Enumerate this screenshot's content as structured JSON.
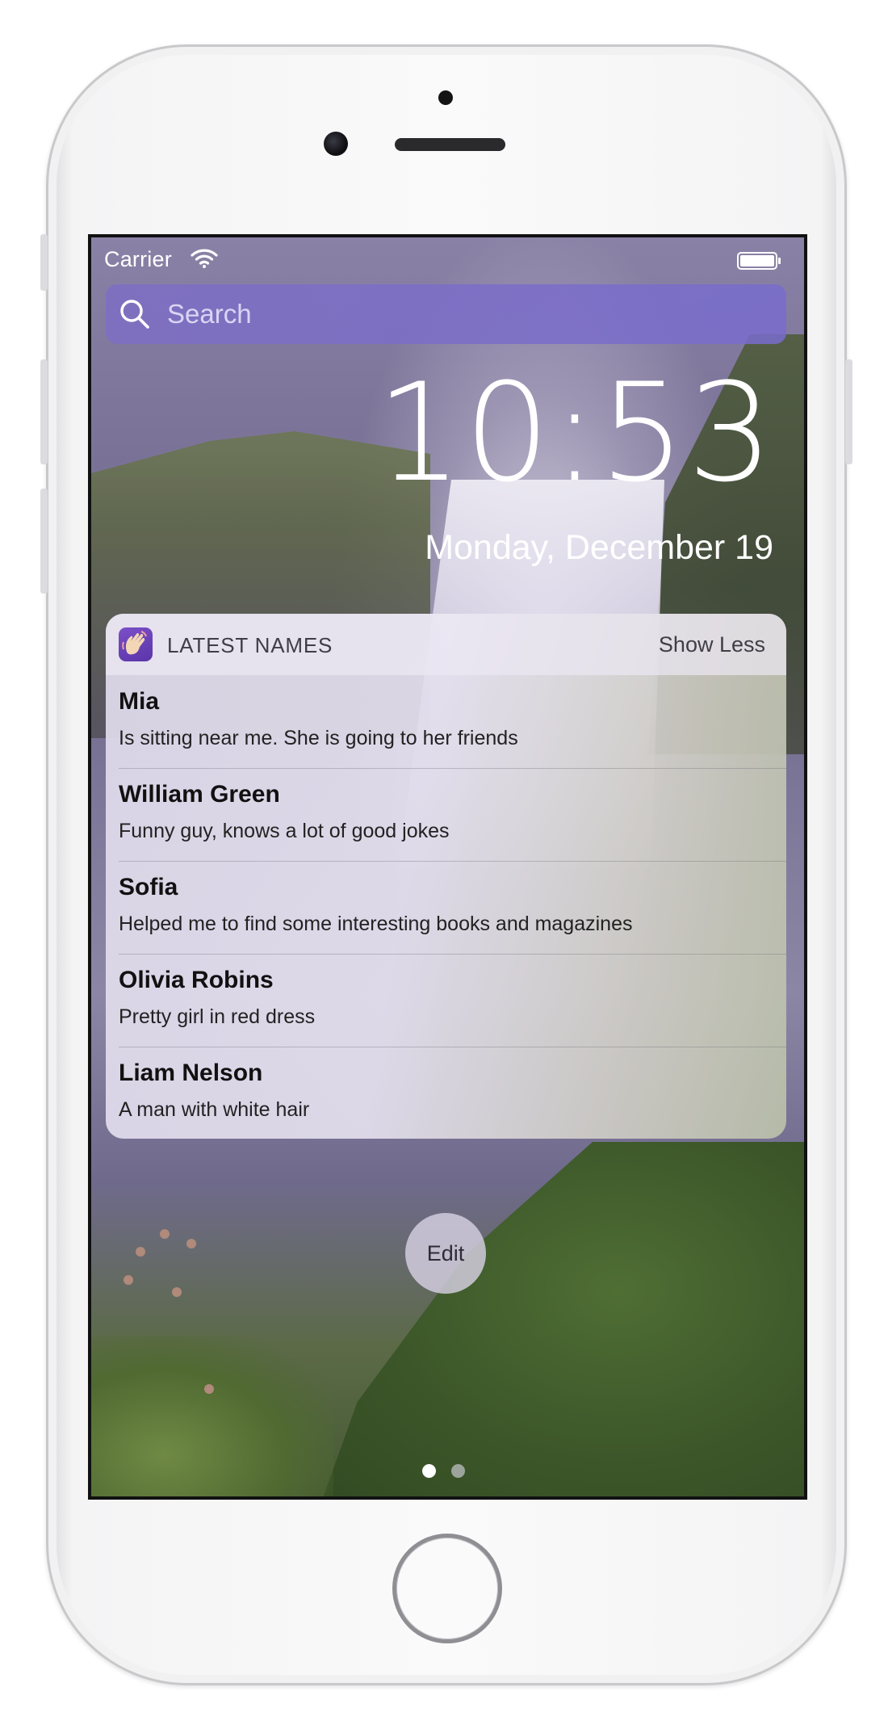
{
  "status_bar": {
    "carrier": "Carrier"
  },
  "search": {
    "placeholder": "Search"
  },
  "lock_screen": {
    "time": "10:53",
    "date": "Monday, December 19"
  },
  "widget": {
    "title": "LATEST NAMES",
    "toggle_label": "Show Less",
    "items": [
      {
        "name": "Mia",
        "description": "Is sitting near me. She is going to her friends"
      },
      {
        "name": "William Green",
        "description": "Funny guy, knows  a lot of good jokes"
      },
      {
        "name": "Sofia",
        "description": "Helped me to find some interesting books and magazines"
      },
      {
        "name": "Olivia Robins",
        "description": "Pretty girl in red dress"
      },
      {
        "name": "Liam Nelson",
        "description": "A man with white hair"
      }
    ]
  },
  "edit_label": "Edit",
  "page_indicator": {
    "pages": 2,
    "current": 1
  },
  "icons": {
    "wifi": "wifi-icon",
    "battery": "battery-icon",
    "search": "search-icon",
    "app": "waving-hand-icon",
    "home": "home-button"
  },
  "colors": {
    "search_bar": "#7e6ec4",
    "app_icon": "#6a42b8",
    "text_primary": "#111111"
  }
}
